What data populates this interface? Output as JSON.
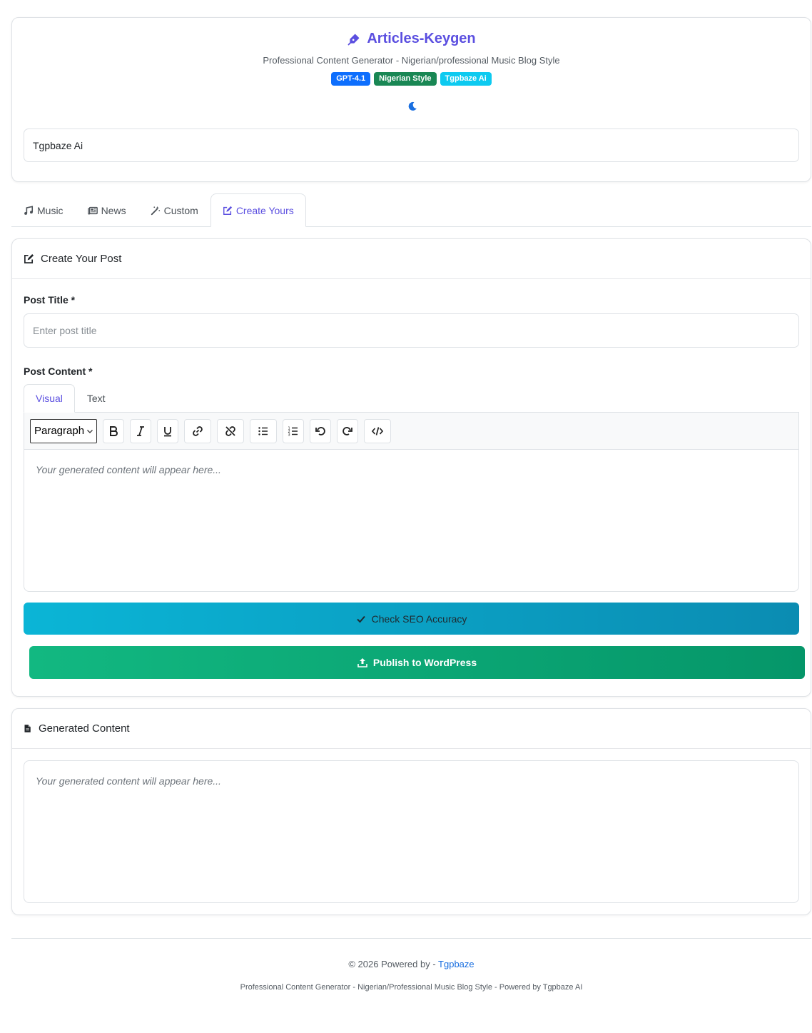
{
  "header": {
    "title": "Articles-Keygen",
    "subtitle": "Professional Content Generator - Nigerian/professional Music Blog Style",
    "badges": [
      {
        "label": "GPT-4.1",
        "color": "#0d6efd"
      },
      {
        "label": "Nigerian Style",
        "color": "#198754"
      },
      {
        "label": "Tgpbaze Ai",
        "color": "#0dcaf0"
      }
    ],
    "theme_icon": "moon-icon",
    "site_value": "Tgpbaze Ai"
  },
  "tabs": [
    {
      "label": "Music",
      "icon": "music-icon"
    },
    {
      "label": "News",
      "icon": "newspaper-icon"
    },
    {
      "label": "Custom",
      "icon": "magic-wand-icon"
    },
    {
      "label": "Create Yours",
      "icon": "edit-icon",
      "active": true
    }
  ],
  "create": {
    "header": "Create Your Post",
    "title_label": "Post Title *",
    "title_placeholder": "Enter post title",
    "content_label": "Post Content *",
    "editor_tabs": [
      {
        "label": "Visual",
        "active": true
      },
      {
        "label": "Text"
      }
    ],
    "format_value": "Paragraph",
    "editor_placeholder": "Your generated content will appear here...",
    "seo_button": "Check SEO Accuracy",
    "publish_button": "Publish to WordPress"
  },
  "generated": {
    "header": "Generated Content",
    "placeholder": "Your generated content will appear here..."
  },
  "footer": {
    "copyright_prefix": "© 2026 Powered by - ",
    "link": "Tgpbaze",
    "tagline": "Professional Content Generator - Nigerian/Professional Music Blog Style - Powered by Tgpbaze AI"
  },
  "colors": {
    "accent": "#5b4fe0",
    "seo_gradient_start": "#0bb5d6",
    "publish_gradient_start": "#12b881"
  }
}
